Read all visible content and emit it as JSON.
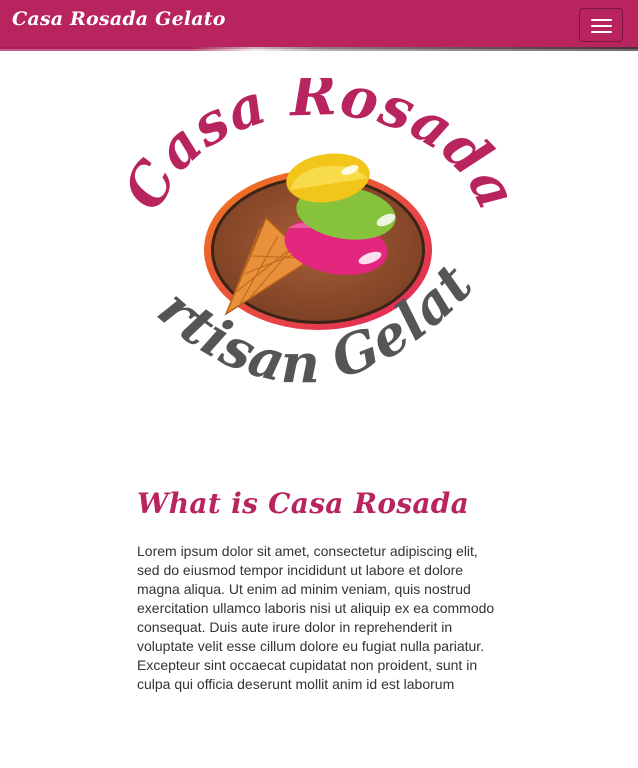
{
  "navbar": {
    "brand": "Casa Rosada Gelato",
    "toggle_icon": "hamburger-menu-icon",
    "colors": {
      "background": "#b8245e",
      "text": "#ffffff"
    }
  },
  "logo": {
    "top_text": "Casa Rosada",
    "bottom_text": "Artisan Gelato",
    "icon": "ice-cream-cone-icon",
    "colors": {
      "top_text": "#b8245e",
      "bottom_text": "#555555",
      "oval_fill": "#8b4a2b",
      "oval_border": "#e8452c",
      "scoop_yellow": "#f2c51b",
      "scoop_green": "#86c23c",
      "scoop_pink": "#e3277f",
      "cone": "#e8903a"
    }
  },
  "main": {
    "heading": "What is Casa Rosada",
    "paragraph": "Lorem ipsum dolor sit amet, consectetur adipiscing elit, sed do eiusmod tempor incididunt ut labore et dolore magna aliqua. Ut enim ad minim veniam, quis nostrud exercitation ullamco laboris nisi ut aliquip ex ea commodo consequat. Duis aute irure dolor in reprehenderit in voluptate velit esse cillum dolore eu fugiat nulla pariatur. Excepteur sint occaecat cupidatat non proident, sunt in culpa qui officia deserunt mollit anim id est laborum",
    "colors": {
      "heading": "#b8245e",
      "text": "#333333"
    }
  }
}
